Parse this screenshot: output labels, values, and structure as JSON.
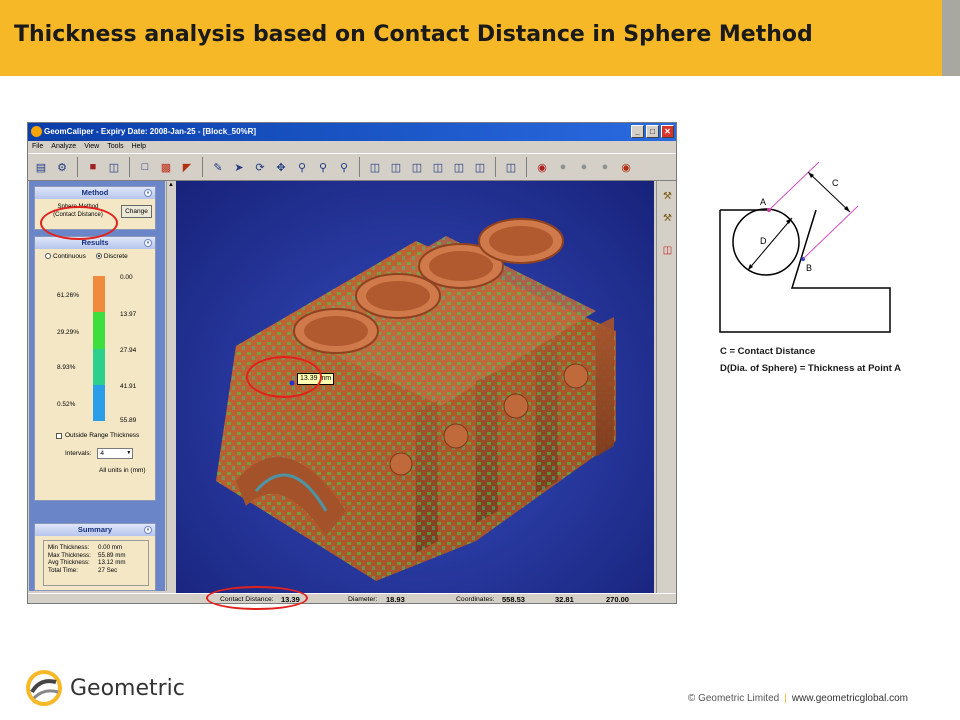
{
  "slide": {
    "title": "Thickness analysis based on Contact Distance in Sphere Method",
    "colors": {
      "title_band": "#f6b826",
      "highlight": "#e2211c",
      "viewport_bg": "#2a3ca4"
    }
  },
  "app": {
    "window_title": "GeomCaliper -  Expiry Date: 2008-Jan-25  - [Block_50%R]",
    "window_buttons": [
      "_",
      "□",
      "✕"
    ],
    "menu": [
      "File",
      "Analyze",
      "View",
      "Tools",
      "Help"
    ],
    "toolbar_icons": [
      "new-file-icon",
      "open-icon",
      "save-icon",
      "print-icon",
      "thickness-icon",
      "analysis-icon",
      "report-icon",
      "select-icon",
      "rotate-icon",
      "pan-icon",
      "zoom-window-icon",
      "zoom-icon",
      "zoom-fit-icon",
      "iso-view-icon",
      "front-view-icon",
      "top-view-icon",
      "side-view-icon",
      "back-view-icon",
      "bottom-view-icon",
      "shaded-icon",
      "wireframe-icon",
      "hidden-line-icon",
      "render-icon",
      "settings-icon"
    ],
    "method": {
      "header": "Method",
      "value_line1": "Sphere Method",
      "value_line2": "(Contact Distance)",
      "change_label": "Change"
    },
    "results": {
      "header": "Results",
      "radio_continuous": "Continuous",
      "radio_discrete": "Discrete",
      "selected": "Discrete",
      "percentages": [
        "61.26%",
        "29.29%",
        "8.93%",
        "0.52%"
      ],
      "ticks": [
        "0.00",
        "13.97",
        "27.94",
        "41.91",
        "55.89"
      ],
      "bands": [
        {
          "color": "#f08a3c",
          "fraction": 0.6126
        },
        {
          "color": "#3ede3e",
          "fraction": 0.2929
        },
        {
          "color": "#2bd08c",
          "fraction": 0.0893
        },
        {
          "color": "#2a9ee8",
          "fraction": 0.0052
        }
      ],
      "outside_range_label": "Outside Range Thickness",
      "intervals_label": "Intervals:",
      "intervals_value": "4",
      "units_text": "All units in (mm)"
    },
    "summary": {
      "header": "Summary",
      "rows": [
        {
          "key": "Min Thickness:",
          "value": "0.00 mm"
        },
        {
          "key": "Max Thickness:",
          "value": "55.89 mm"
        },
        {
          "key": "Avg Thickness:",
          "value": "13.12 mm"
        },
        {
          "key": "Total Time:",
          "value": "27 Sec"
        }
      ]
    },
    "viewport": {
      "measure_tag": "13.39 mm"
    },
    "statusbar": {
      "contact_label": "Contact Distance:",
      "contact_value": "13.39",
      "diameter_label": "Diameter:",
      "diameter_value": "18.93",
      "coordinates_label": "Coordinates:",
      "coord_x": "558.53",
      "coord_y": "32.81",
      "coord_z": "270.00"
    }
  },
  "diagram": {
    "label_a": "A",
    "label_b": "B",
    "label_c": "C",
    "label_d": "D",
    "legend_c": "C = Contact Distance",
    "legend_d": "D(Dia. of Sphere) = Thickness at Point A"
  },
  "footer": {
    "brand": "Geometric",
    "copyright": "© Geometric Limited",
    "separator": "|",
    "url": "www.geometricglobal.com"
  }
}
